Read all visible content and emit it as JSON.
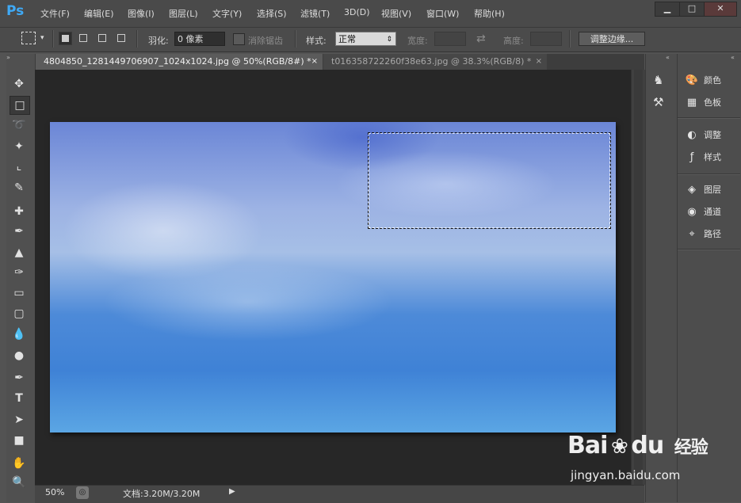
{
  "app": {
    "logo": "Ps",
    "menus": [
      "文件(F)",
      "编辑(E)",
      "图像(I)",
      "图层(L)",
      "文字(Y)",
      "选择(S)",
      "滤镜(T)",
      "3D(D)",
      "视图(V)",
      "窗口(W)",
      "帮助(H)"
    ],
    "window_controls": [
      "minimize-icon",
      "maximize-icon",
      "close-icon"
    ]
  },
  "options": {
    "feather_label": "羽化:",
    "feather_value": "0 像素",
    "antialias_label": "消除锯齿",
    "style_label": "样式:",
    "style_value": "正常",
    "width_label": "宽度:",
    "height_label": "高度:",
    "refine_edge": "调整边缘..."
  },
  "tabs": [
    {
      "label": "4804850_1281449706907_1024x1024.jpg @ 50%(RGB/8#) *",
      "active": true
    },
    {
      "label": "t016358722260f38e63.jpg @ 38.3%(RGB/8) *",
      "active": false
    }
  ],
  "tools": [
    "move-icon",
    "rect-marquee-icon",
    "lasso-icon",
    "magic-wand-icon",
    "crop-icon",
    "eyedropper-icon",
    "healing-brush-icon",
    "brush-icon",
    "clone-stamp-icon",
    "history-brush-icon",
    "eraser-icon",
    "gradient-icon",
    "blur-icon",
    "dodge-icon",
    "pen-icon",
    "type-icon",
    "path-select-icon",
    "rectangle-shape-icon",
    "hand-icon",
    "zoom-icon"
  ],
  "status": {
    "zoom": "50%",
    "doc": "文档:3.20M/3.20M"
  },
  "panels": [
    {
      "label": "颜色",
      "icon": "palette-icon"
    },
    {
      "label": "色板",
      "icon": "swatches-icon"
    },
    {
      "label": "调整",
      "icon": "adjust-icon"
    },
    {
      "label": "样式",
      "icon": "styles-icon"
    },
    {
      "label": "图层",
      "icon": "layers-icon"
    },
    {
      "label": "通道",
      "icon": "channels-icon"
    },
    {
      "label": "路径",
      "icon": "paths-icon"
    }
  ],
  "watermark": {
    "brand": "Bai",
    "brand2": "du",
    "suffix": "经验",
    "url": "jingyan.baidu.com"
  },
  "colors": {
    "accent": "#3fa9f5",
    "canvas_bg": "#272727",
    "ui_bg": "#535353"
  }
}
